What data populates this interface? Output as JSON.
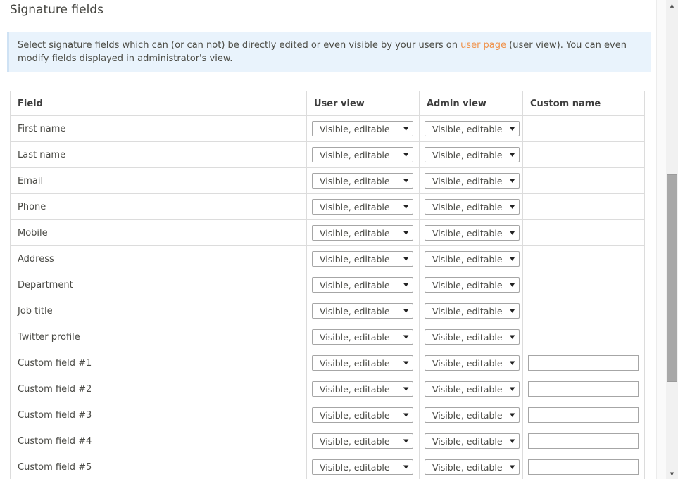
{
  "page": {
    "title": "Signature fields"
  },
  "notice": {
    "text_before_link": "Select signature fields which can (or can not) be directly edited or even visible by your users on ",
    "link_text": "user page",
    "text_after_link": " (user view). You can even modify fields displayed in administrator's view."
  },
  "table": {
    "headers": [
      "Field",
      "User view",
      "Admin view",
      "Custom name"
    ],
    "rows": [
      {
        "field": "First name",
        "user_view": "Visible, editable",
        "admin_view": "Visible, editable",
        "has_custom_name_input": false,
        "custom_name_value": ""
      },
      {
        "field": "Last name",
        "user_view": "Visible, editable",
        "admin_view": "Visible, editable",
        "has_custom_name_input": false,
        "custom_name_value": ""
      },
      {
        "field": "Email",
        "user_view": "Visible, editable",
        "admin_view": "Visible, editable",
        "has_custom_name_input": false,
        "custom_name_value": ""
      },
      {
        "field": "Phone",
        "user_view": "Visible, editable",
        "admin_view": "Visible, editable",
        "has_custom_name_input": false,
        "custom_name_value": ""
      },
      {
        "field": "Mobile",
        "user_view": "Visible, editable",
        "admin_view": "Visible, editable",
        "has_custom_name_input": false,
        "custom_name_value": ""
      },
      {
        "field": "Address",
        "user_view": "Visible, editable",
        "admin_view": "Visible, editable",
        "has_custom_name_input": false,
        "custom_name_value": ""
      },
      {
        "field": "Department",
        "user_view": "Visible, editable",
        "admin_view": "Visible, editable",
        "has_custom_name_input": false,
        "custom_name_value": ""
      },
      {
        "field": "Job title",
        "user_view": "Visible, editable",
        "admin_view": "Visible, editable",
        "has_custom_name_input": false,
        "custom_name_value": ""
      },
      {
        "field": "Twitter profile",
        "user_view": "Visible, editable",
        "admin_view": "Visible, editable",
        "has_custom_name_input": false,
        "custom_name_value": ""
      },
      {
        "field": "Custom field #1",
        "user_view": "Visible, editable",
        "admin_view": "Visible, editable",
        "has_custom_name_input": true,
        "custom_name_value": ""
      },
      {
        "field": "Custom field #2",
        "user_view": "Visible, editable",
        "admin_view": "Visible, editable",
        "has_custom_name_input": true,
        "custom_name_value": ""
      },
      {
        "field": "Custom field #3",
        "user_view": "Visible, editable",
        "admin_view": "Visible, editable",
        "has_custom_name_input": true,
        "custom_name_value": ""
      },
      {
        "field": "Custom field #4",
        "user_view": "Visible, editable",
        "admin_view": "Visible, editable",
        "has_custom_name_input": true,
        "custom_name_value": ""
      },
      {
        "field": "Custom field #5",
        "user_view": "Visible, editable",
        "admin_view": "Visible, editable",
        "has_custom_name_input": true,
        "custom_name_value": ""
      }
    ]
  },
  "icons": {
    "dropdown_arrow": "▼",
    "scroll_up_arrow": "▲",
    "scroll_down_arrow": "▼"
  },
  "colors": {
    "notice_background": "#e9f3fc",
    "link_accent": "#f0924a",
    "table_border": "#dcdcdc"
  }
}
